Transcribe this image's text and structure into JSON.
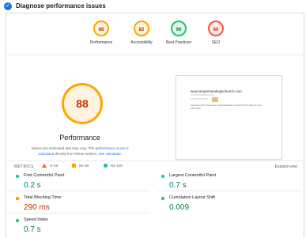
{
  "header": {
    "title": "Diagnose performance issues",
    "check_glyph": "✓"
  },
  "categories": [
    {
      "score": "88",
      "label": "Performance",
      "status": "orange"
    },
    {
      "score": "82",
      "label": "Accessibility",
      "status": "orange"
    },
    {
      "score": "96",
      "label": "Best Practices",
      "status": "green"
    },
    {
      "score": "60",
      "label": "SEO",
      "status": "red"
    }
  ],
  "performance": {
    "score": "88",
    "title": "Performance",
    "desc_before": "Values are estimated and may vary. The ",
    "desc_link1": "performance score is calculated",
    "desc_middle": " directly from these metrics. ",
    "desc_link2": "See calculator."
  },
  "legend": [
    {
      "range": "0–49",
      "shape": "triangle",
      "color": "#ff4e42"
    },
    {
      "range": "50–89",
      "shape": "square",
      "color": "#ffa400"
    },
    {
      "range": "90–100",
      "shape": "circle",
      "color": "#0cce6b"
    }
  ],
  "screenshot": {
    "site": "www.ampersandsignchurch.com",
    "caption": "Upcoming events have been scheduled please contact the front desk for more information"
  },
  "metrics": {
    "label": "METRICS",
    "expand_label": "Expand view",
    "items": [
      {
        "name": "First Contentful Paint",
        "value": "0.2 s",
        "status": "good"
      },
      {
        "name": "Largest Contentful Paint",
        "value": "0.7 s",
        "status": "good"
      },
      {
        "name": "Total Blocking Time",
        "value": "290 ms",
        "status": "average"
      },
      {
        "name": "Cumulative Layout Shift",
        "value": "0.009",
        "status": "good"
      },
      {
        "name": "Speed Index",
        "value": "0.7 s",
        "status": "good"
      }
    ]
  },
  "colors": {
    "accent": "#1a73e8",
    "good": "#0cce6b",
    "average": "#ffa400",
    "poor": "#ff4e42"
  }
}
